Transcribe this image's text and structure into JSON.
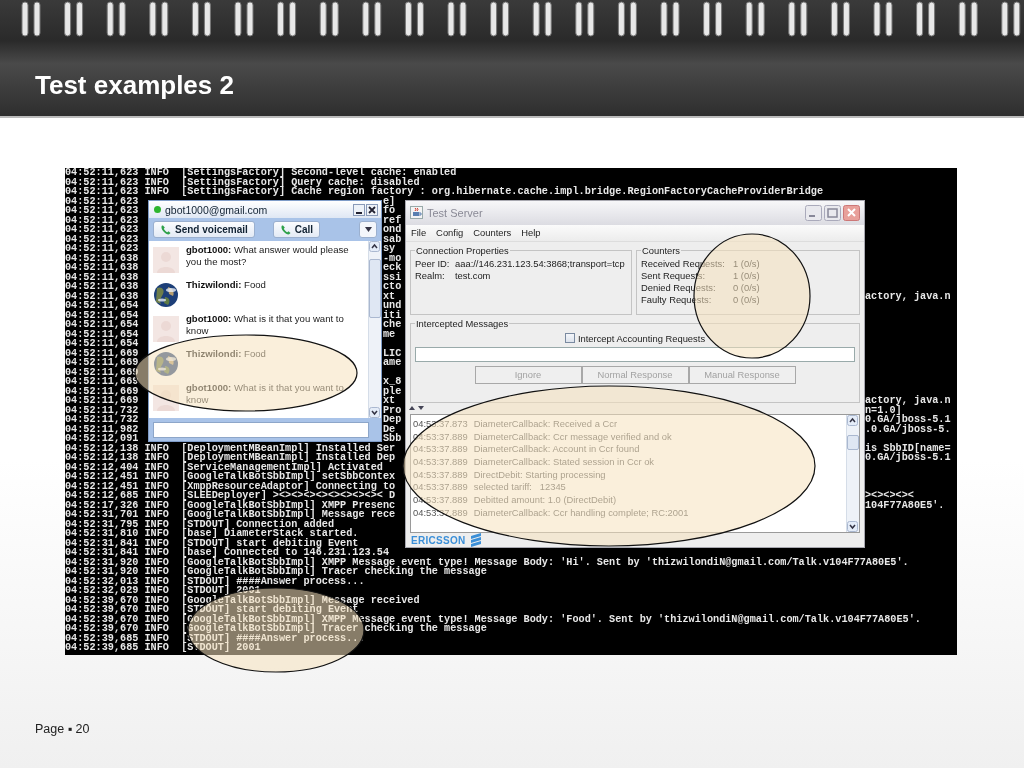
{
  "slide": {
    "title": "Test examples 2",
    "footer": "Page ▪ 20"
  },
  "console": {
    "rows": [
      {
        "kind": "full",
        "text": "04:52:11,623 INFO  [SettingsFactory] Second-level cache: enabled"
      },
      {
        "kind": "full",
        "text": "04:52:11,623 INFO  [SettingsFactory] Query cache: disabled"
      },
      {
        "kind": "full",
        "text": "04:52:11,623 INFO  [SettingsFactory] Cache region factory : org.hibernate.cache.impl.bridge.RegionFactoryCacheProviderBridge"
      },
      {
        "kind": "split",
        "left": "04:52:11,623",
        "middle": "e]"
      },
      {
        "kind": "split",
        "left": "04:52:11,623",
        "middle": "fo"
      },
      {
        "kind": "split",
        "left": "04:52:11,623",
        "middle": "ref"
      },
      {
        "kind": "split",
        "left": "04:52:11,623",
        "middle": "ond"
      },
      {
        "kind": "split",
        "left": "04:52:11,623",
        "middle": "sab"
      },
      {
        "kind": "split",
        "left": "04:52:11,623",
        "middle": "sy"
      },
      {
        "kind": "split",
        "left": "04:52:11,638",
        "middle": "-mo"
      },
      {
        "kind": "split",
        "left": "04:52:11,638",
        "middle": "eck"
      },
      {
        "kind": "split",
        "left": "04:52:11,638",
        "middle": "ssi"
      },
      {
        "kind": "split",
        "left": "04:52:11,638",
        "middle": "cto"
      },
      {
        "kind": "split",
        "left": "04:52:11,638",
        "middle": "xt",
        "right": "actory, java.n"
      },
      {
        "kind": "split",
        "left": "04:52:11,654",
        "middle": "und"
      },
      {
        "kind": "split",
        "left": "04:52:11,654",
        "middle": "iti"
      },
      {
        "kind": "split",
        "left": "04:52:11,654",
        "middle": "che"
      },
      {
        "kind": "split",
        "left": "04:52:11,654",
        "middle": "me"
      },
      {
        "kind": "split",
        "left": "04:52:11,654"
      },
      {
        "kind": "split",
        "left": "04:52:11,669",
        "middle": "LIC"
      },
      {
        "kind": "split",
        "left": "04:52:11,669",
        "middle": "ame"
      },
      {
        "kind": "split",
        "left": "04:52:11,669"
      },
      {
        "kind": "split",
        "left": "04:52:11,669",
        "middle": "x_8"
      },
      {
        "kind": "split",
        "left": "04:52:11,669",
        "middle": "ple"
      },
      {
        "kind": "split",
        "left": "04:52:11,669",
        "middle": "xt",
        "right": "actory, java.n"
      },
      {
        "kind": "split",
        "left": "04:52:11,732",
        "middle": "Pro",
        "right": "n=1.0]"
      },
      {
        "kind": "split",
        "left": "04:52:11,732",
        "middle": "Dep",
        "right": "0.GA/jboss-5.1"
      },
      {
        "kind": "split",
        "left": "04:52:11,982",
        "middle": "De",
        "right": ".0.GA/jboss-5."
      },
      {
        "kind": "split",
        "left": "04:52:12,091",
        "middle": "Sbb"
      },
      {
        "kind": "beside",
        "left": "04:52:12,138 INFO  [DeploymentMBeanImpl] Installed Ser",
        "right": "is SbbID[name="
      },
      {
        "kind": "beside",
        "left": "04:52:12,138 INFO  [DeploymentMBeanImpl] Installed Dep",
        "right": "0.GA/jboss-5.1"
      },
      {
        "kind": "beside",
        "left": "04:52:12,404 INFO  [ServiceManagementImpl] Activated"
      },
      {
        "kind": "beside",
        "left": "04:52:12,451 INFO  [GoogleTalkBotSbbImpl] setSbbContex"
      },
      {
        "kind": "beside",
        "left": "04:52:12,451 INFO  [XmppResourceAdaptor] Connecting to"
      },
      {
        "kind": "beside",
        "left": "04:52:12,685 INFO  [SLEEDeployer] ><><><><><><><><>< D",
        "right": "><><><><"
      },
      {
        "kind": "beside",
        "left": "04:52:17,326 INFO  [GoogleTalkBotSbbImpl] XMPP Presenc",
        "right": "104F77A80E5'."
      },
      {
        "kind": "beside",
        "left": "04:52:31,701 INFO  [GoogleTalkBotSbbImpl] Message rece"
      },
      {
        "kind": "beside",
        "left": "04:52:31,795 INFO  [STDOUT] Connection added"
      },
      {
        "kind": "beside",
        "left": "04:52:31,810 INFO  [base] DiameterStack started."
      },
      {
        "kind": "beside",
        "left": "04:52:31,841 INFO  [STDOUT] start debiting Event"
      },
      {
        "kind": "full",
        "text": "04:52:31,841 INFO  [base] Connected to 146.231.123.54"
      },
      {
        "kind": "full",
        "text": "04:52:31,920 INFO  [GoogleTalkBotSbbImpl] XMPP Message event type! Message Body: 'Hi'. Sent by 'thizwilondiN@gmail.com/Talk.v104F77A80E5'."
      },
      {
        "kind": "full",
        "text": "04:52:31,920 INFO  [GoogleTalkBotSbbImpl] Tracer checking the message"
      },
      {
        "kind": "full",
        "text": "04:52:32,013 INFO  [STDOUT] ####Answer process..."
      },
      {
        "kind": "full",
        "text": "04:52:32,029 INFO  [STDOUT] 2001"
      },
      {
        "kind": "full",
        "text": "04:52:39,670 INFO  [GoogleTalkBotSbbImpl] Message received"
      },
      {
        "kind": "full",
        "text": "04:52:39,670 INFO  [STDOUT] start debiting Event"
      },
      {
        "kind": "full",
        "text": "04:52:39,670 INFO  [GoogleTalkBotSbbImpl] XMPP Message event type! Message Body: 'Food'. Sent by 'thizwilondiN@gmail.com/Talk.v104F77A80E5'."
      },
      {
        "kind": "full",
        "text": "04:52:39,670 INFO  [GoogleTalkBotSbbImpl] Tracer checking the message"
      },
      {
        "kind": "full",
        "text": "04:52:39,685 INFO  [STDOUT] ####Answer process..."
      },
      {
        "kind": "full",
        "text": "04:52:39,685 INFO  [STDOUT] 2001"
      }
    ]
  },
  "chat_window": {
    "title": "gbot1000@gmail.com",
    "online": true,
    "buttons": [
      {
        "kind": "voicemail",
        "label": "Send voicemail"
      },
      {
        "kind": "call",
        "label": "Call"
      }
    ],
    "messages": [
      {
        "kind": "person",
        "text": "**gbot1000:** What answer would please you the most?"
      },
      {
        "kind": "picture",
        "text": "**Thizwilondi:** Food"
      },
      {
        "kind": "person",
        "text": "**gbot1000:** What is it that you want to know"
      },
      {
        "kind": "picture",
        "text": "**Thizwilondi:** Food"
      },
      {
        "kind": "person",
        "text": "**gbot1000:** What is it that you want to know"
      }
    ]
  },
  "test_server": {
    "title": "Test Server",
    "menu": [
      "File",
      "Config",
      "Counters",
      "Help"
    ],
    "connection": {
      "title": "Connection Properties",
      "fields": [
        {
          "label": "Peer ID:",
          "value": "aaa://146.231.123.54:3868;transport=tcp"
        },
        {
          "label": "Realm:",
          "value": "test.com"
        }
      ]
    },
    "counters": {
      "title": "Counters",
      "items": [
        {
          "label": "Received Requests:",
          "value": "1 (0/s)"
        },
        {
          "label": "Sent Requests:",
          "value": "1 (0/s)"
        },
        {
          "label": "Denied Requests:",
          "value": "0 (0/s)"
        },
        {
          "label": "Faulty Requests:",
          "value": "0 (0/s)"
        }
      ]
    },
    "intercepted": {
      "title": "Intercepted Messages",
      "checkbox": {
        "label": "Intercept Accounting Requests",
        "checked": false
      },
      "buttons": [
        {
          "label": "Ignore",
          "disabled": true
        },
        {
          "label": "Normal Response",
          "disabled": true
        },
        {
          "label": "Manual Response",
          "disabled": true
        }
      ]
    },
    "log": [
      {
        "time": "04:53:37.873",
        "message": "DiameterCallback: Received a Ccr"
      },
      {
        "time": "04:53:37.889",
        "message": "DiameterCallback: Ccr message verified and ok"
      },
      {
        "time": "04:53:37.889",
        "message": "DiameterCallback: Account in Ccr found"
      },
      {
        "time": "04:53:37.889",
        "message": "DiameterCallback: Stated session in Ccr ok"
      },
      {
        "time": "04:53:37.889",
        "message": "DirectDebit: Starting processing"
      },
      {
        "time": "04:53:37.889",
        "message": "selected tariff:   12345"
      },
      {
        "time": "04:53:37.889",
        "message": "Debitted amount: 1.0 (DirectDebit)"
      },
      {
        "time": "04:53:37.889",
        "message": "DiameterCallback: Ccr handling complete; RC:2001"
      }
    ],
    "footer": {
      "logo": "ERICSSON"
    }
  }
}
